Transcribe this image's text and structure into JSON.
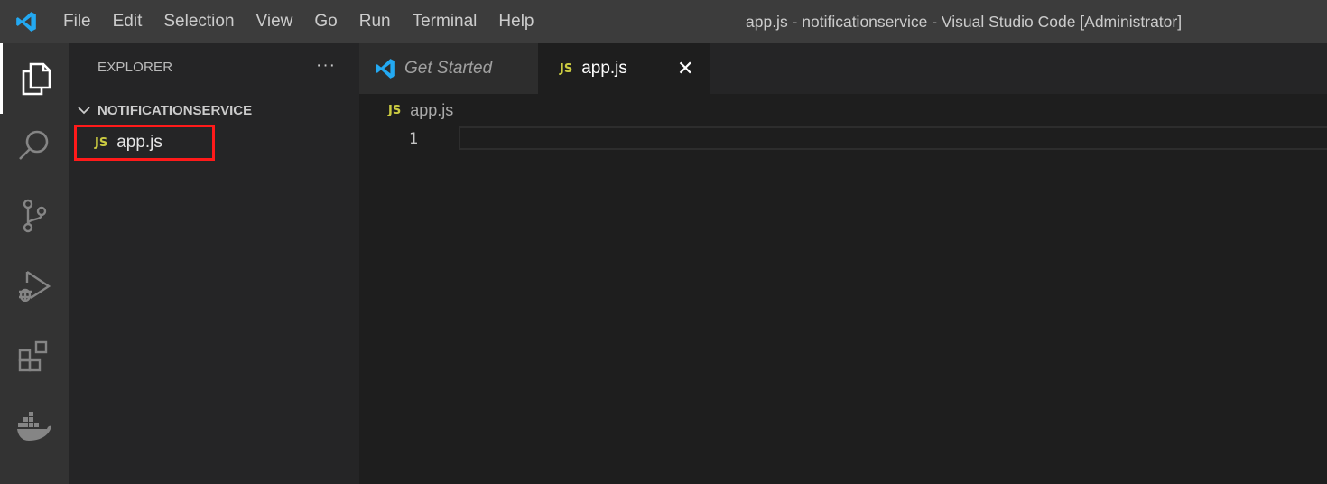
{
  "menu": [
    "File",
    "Edit",
    "Selection",
    "View",
    "Go",
    "Run",
    "Terminal",
    "Help"
  ],
  "window_title": "app.js - notificationservice - Visual Studio Code [Administrator]",
  "sidebar": {
    "header": "EXPLORER",
    "more": "···",
    "folder": "NOTIFICATIONSERVICE",
    "files": [
      {
        "badge": "JS",
        "name": "app.js"
      }
    ]
  },
  "tabs": [
    {
      "label": "Get Started",
      "icon": "vscode-logo-icon"
    },
    {
      "label": "app.js",
      "badge": "JS",
      "close": "✕"
    }
  ],
  "breadcrumb": {
    "badge": "JS",
    "label": "app.js"
  },
  "editor": {
    "line_numbers": [
      "1"
    ]
  },
  "activity_icons": [
    "explorer-icon",
    "search-icon",
    "source-control-icon",
    "run-debug-icon",
    "extensions-icon",
    "docker-icon"
  ],
  "colors": {
    "titlebar": "#3c3c3c",
    "activitybar": "#333333",
    "sidebar": "#252526",
    "editor": "#1e1e1e",
    "js_badge": "#cbcb41",
    "vscode_blue": "#23a9f2",
    "highlight_box": "#ff1a1a"
  }
}
